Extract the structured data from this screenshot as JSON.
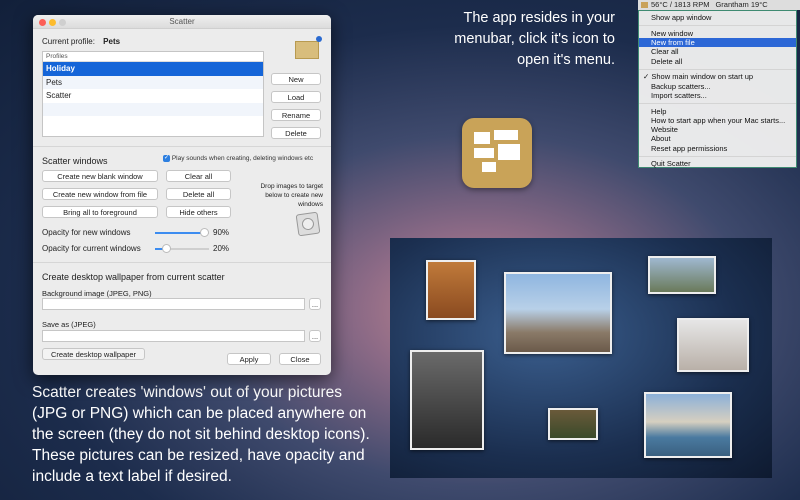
{
  "menubar": {
    "status1": "56°C / 1813 RPM",
    "status2": "Grantham 19°C"
  },
  "menu": {
    "items": [
      {
        "label": "Show app window",
        "sep_after": true
      },
      {
        "label": "New window"
      },
      {
        "label": "New from file",
        "highlighted": true
      },
      {
        "label": "Clear all"
      },
      {
        "label": "Delete all",
        "sep_after": true
      },
      {
        "label": "✓ Show main window on start up"
      },
      {
        "label": "Backup scatters..."
      },
      {
        "label": "Import scatters...",
        "sep_after": true
      },
      {
        "label": "Help"
      },
      {
        "label": "How to start app when your Mac starts..."
      },
      {
        "label": "Website"
      },
      {
        "label": "About"
      },
      {
        "label": "Reset app permissions",
        "sep_after": true
      },
      {
        "label": "Quit Scatter"
      }
    ]
  },
  "window": {
    "title": "Scatter",
    "current_profile_label": "Current profile:",
    "current_profile": "Pets",
    "profiles_header": "Profiles",
    "profiles": [
      "Holiday",
      "Pets",
      "Scatter"
    ],
    "selected_profile": "Holiday",
    "profile_buttons": {
      "new": "New",
      "load": "Load",
      "rename": "Rename",
      "delete": "Delete"
    },
    "scatter_windows": {
      "heading": "Scatter windows",
      "play_sounds": "Play sounds when creating, deleting windows etc",
      "play_sounds_checked": true,
      "create_blank": "Create new blank window",
      "create_from_file": "Create new window from file",
      "bring_foreground": "Bring all to foreground",
      "clear_all": "Clear all",
      "delete_all": "Delete all",
      "hide_others": "Hide others",
      "drop_hint": "Drop images to target below to create new windows",
      "opacity_new_label": "Opacity for new windows",
      "opacity_new": 90,
      "opacity_new_text": "90%",
      "opacity_current_label": "Opacity for current windows",
      "opacity_current": 20,
      "opacity_current_text": "20%"
    },
    "wallpaper": {
      "heading": "Create desktop wallpaper from current scatter",
      "bg_label": "Background image (JPEG, PNG)",
      "bg_value": "",
      "save_label": "Save as (JPEG)",
      "save_value": "",
      "browse": "...",
      "create": "Create desktop wallpaper",
      "apply": "Apply",
      "close": "Close"
    }
  },
  "captions": {
    "top": "The app resides in your menubar, click it's icon to open it's menu.",
    "bottom": "Scatter creates 'windows' out of your pictures (JPG or PNG) which can be placed anywhere on the screen (they do not sit behind desktop icons). These pictures can be resized, have opacity and include a text label if desired."
  }
}
